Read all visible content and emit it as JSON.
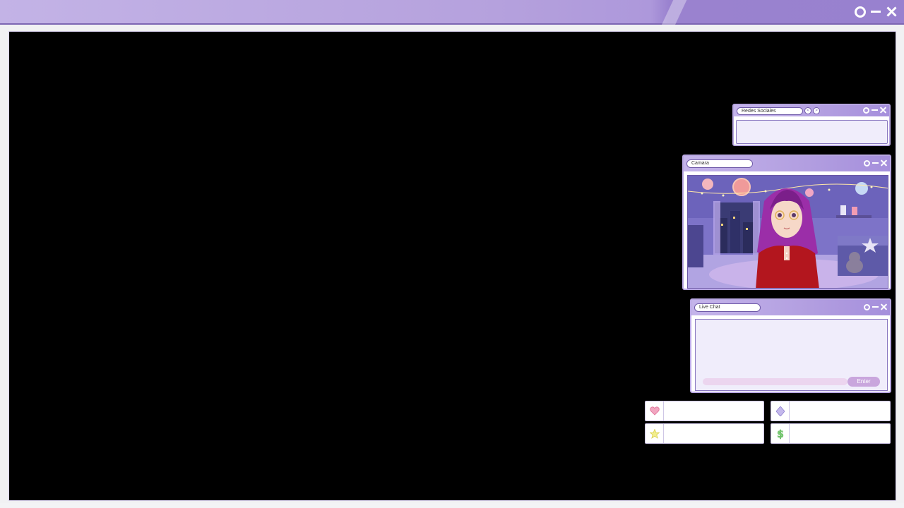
{
  "window": {
    "controls": [
      "circle-icon",
      "minimize-icon",
      "close-icon"
    ],
    "accent": "#b5a1dd",
    "screen_color": "#000000"
  },
  "panels": {
    "social": {
      "title": "Redes Sociales",
      "nav": [
        "<",
        ">"
      ]
    },
    "camera": {
      "title": "Camara"
    },
    "chat": {
      "title": "Live Chat",
      "input_value": "",
      "send_label": "Enter"
    }
  },
  "stats": [
    {
      "icon": "heart-icon",
      "color": "#e98bb0",
      "value": ""
    },
    {
      "icon": "diamond-icon",
      "color": "#a89ad6",
      "value": ""
    },
    {
      "icon": "star-icon",
      "color": "#e9e26a",
      "value": ""
    },
    {
      "icon": "dollar-icon",
      "color": "#7fd07a",
      "value": ""
    }
  ]
}
